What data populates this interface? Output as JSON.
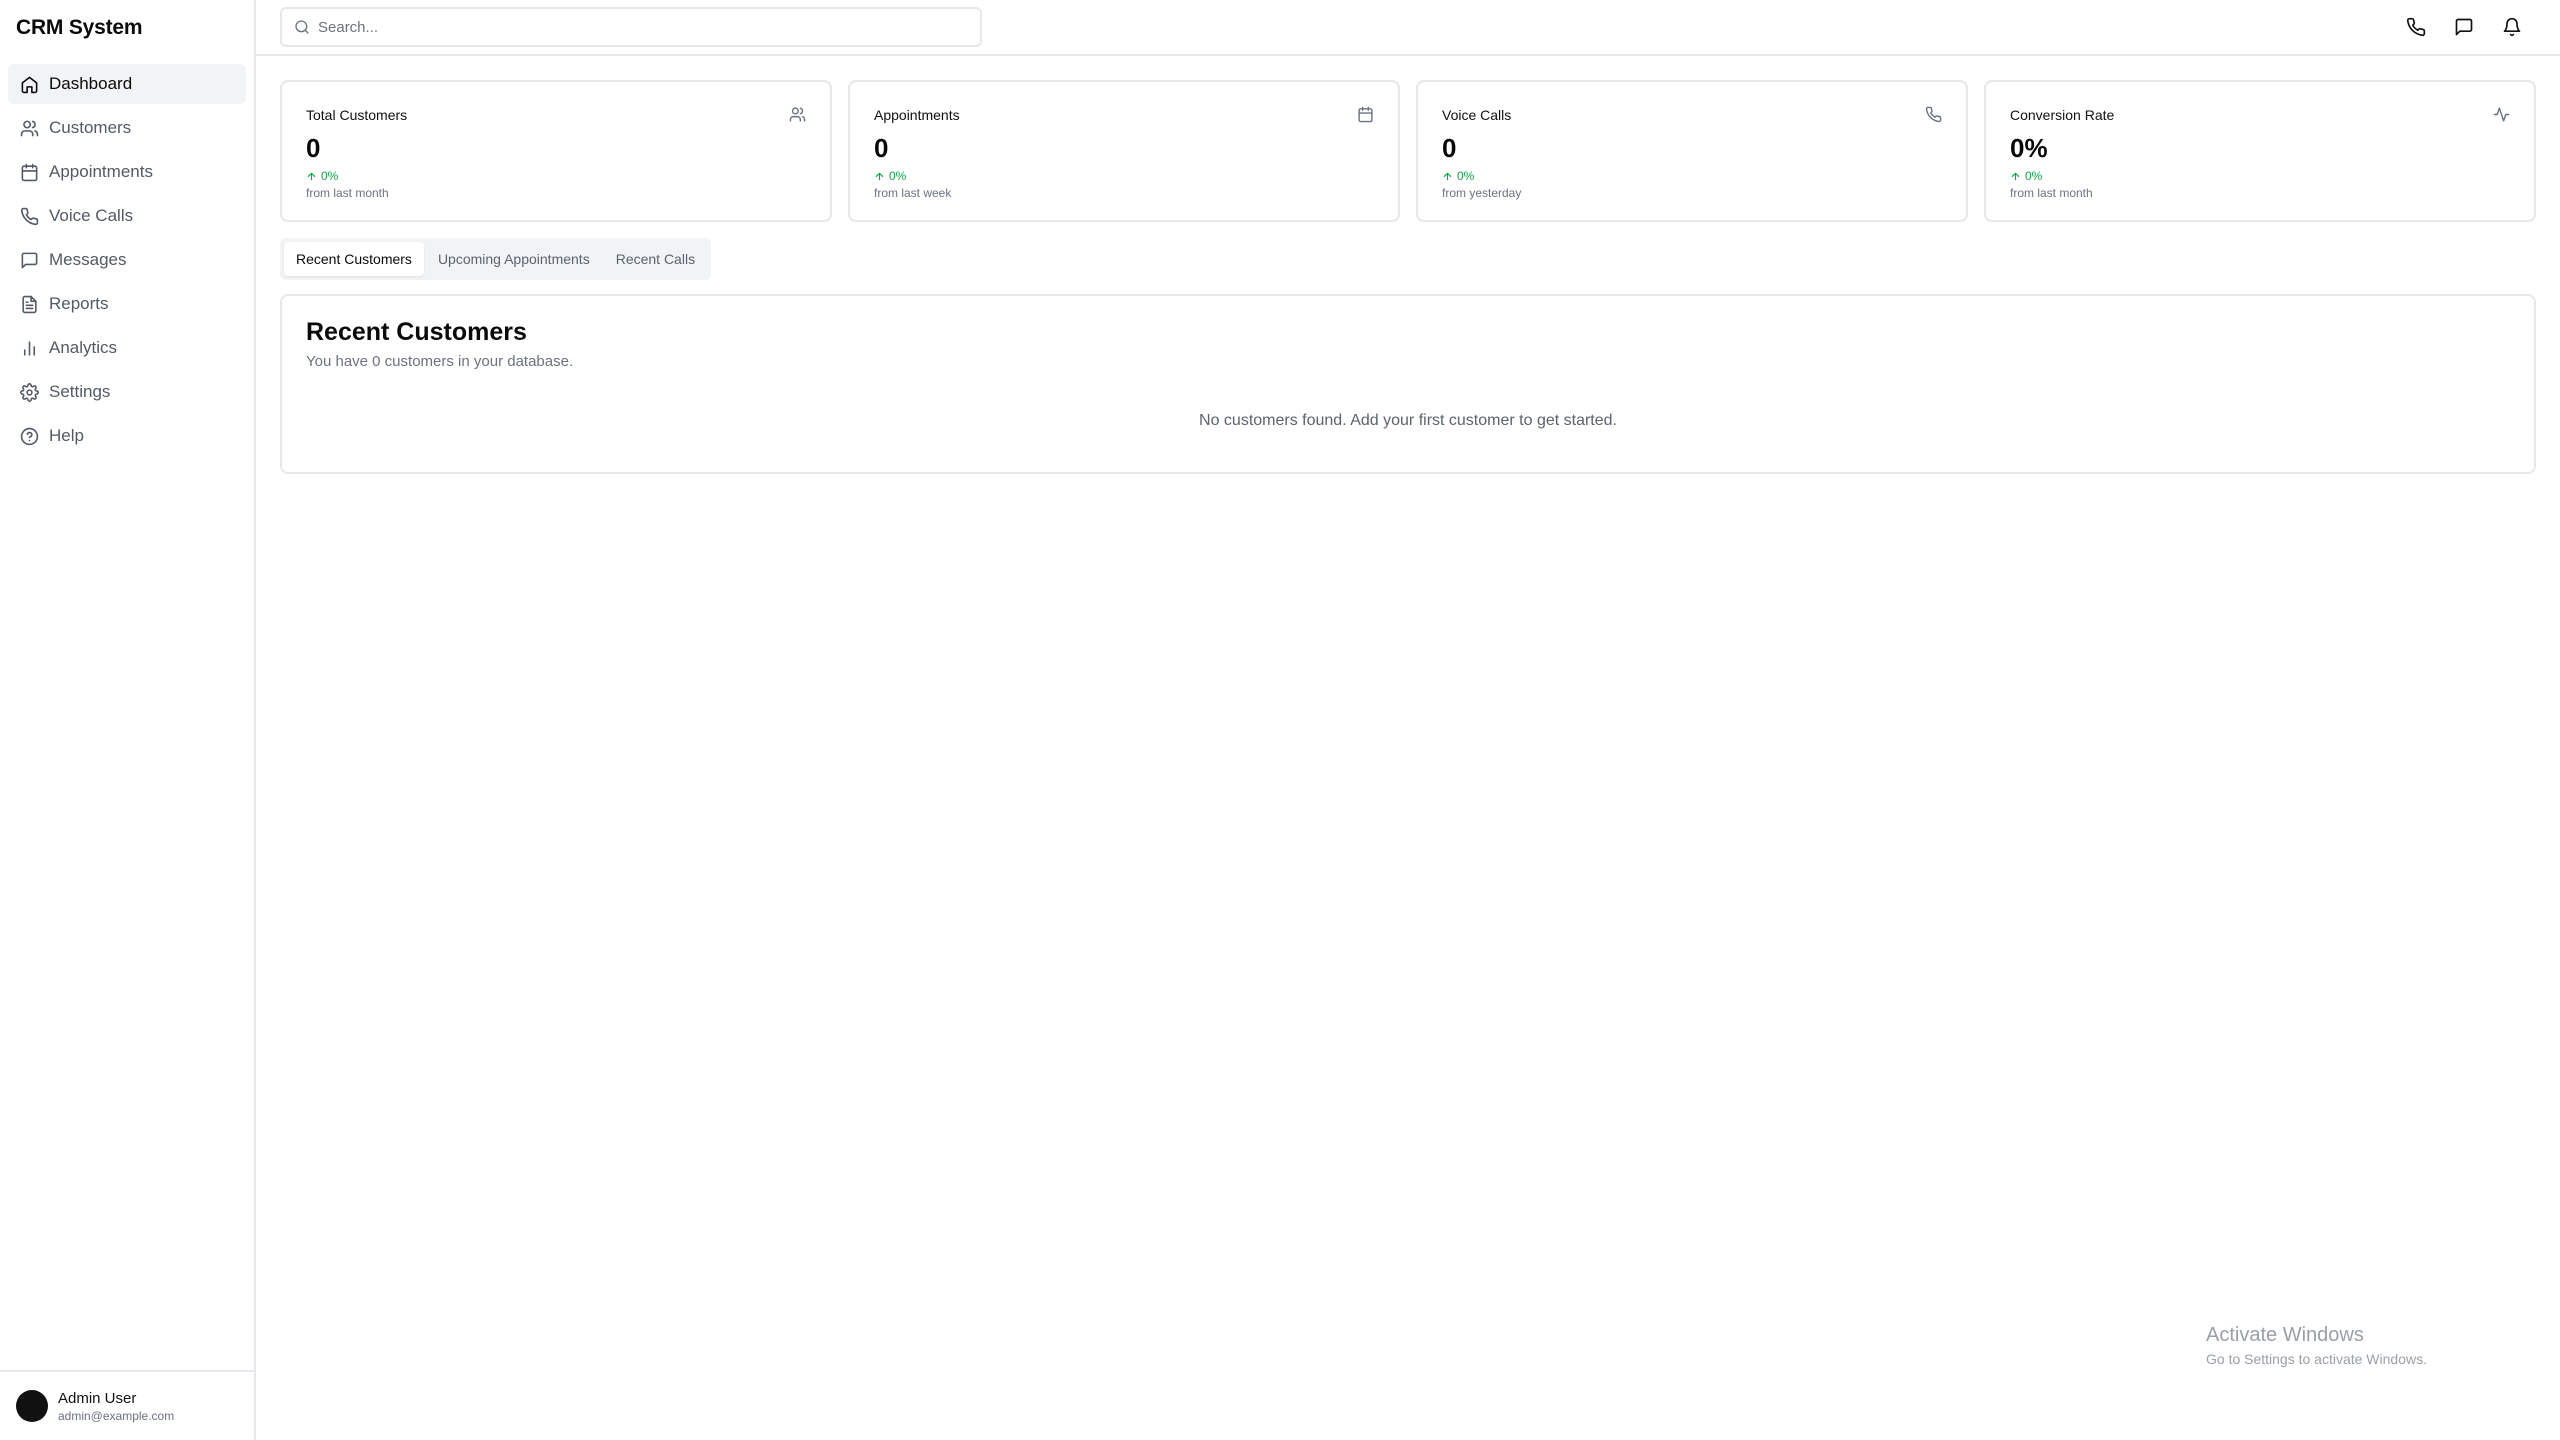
{
  "app": {
    "title": "CRM System"
  },
  "sidebar": {
    "items": [
      {
        "label": "Dashboard",
        "icon": "home-icon",
        "active": true
      },
      {
        "label": "Customers",
        "icon": "users-icon"
      },
      {
        "label": "Appointments",
        "icon": "calendar-icon"
      },
      {
        "label": "Voice Calls",
        "icon": "phone-icon"
      },
      {
        "label": "Messages",
        "icon": "message-icon"
      },
      {
        "label": "Reports",
        "icon": "file-text-icon"
      },
      {
        "label": "Analytics",
        "icon": "bar-chart-icon"
      },
      {
        "label": "Settings",
        "icon": "gear-icon"
      },
      {
        "label": "Help",
        "icon": "help-circle-icon"
      }
    ],
    "user": {
      "name": "Admin User",
      "email": "admin@example.com"
    }
  },
  "topbar": {
    "search_placeholder": "Search...",
    "actions": [
      "phone-icon",
      "message-icon",
      "bell-icon"
    ]
  },
  "stats": [
    {
      "title": "Total Customers",
      "value": "0",
      "change": "0%",
      "sub": "from last month",
      "icon": "users-icon"
    },
    {
      "title": "Appointments",
      "value": "0",
      "change": "0%",
      "sub": "from last week",
      "icon": "calendar-icon"
    },
    {
      "title": "Voice Calls",
      "value": "0",
      "change": "0%",
      "sub": "from yesterday",
      "icon": "phone-icon"
    },
    {
      "title": "Conversion Rate",
      "value": "0%",
      "change": "0%",
      "sub": "from last month",
      "icon": "activity-icon"
    }
  ],
  "tabs": [
    {
      "label": "Recent Customers",
      "active": true
    },
    {
      "label": "Upcoming Appointments"
    },
    {
      "label": "Recent Calls"
    }
  ],
  "panel": {
    "title": "Recent Customers",
    "subtitle": "You have 0 customers in your database.",
    "empty": "No customers found. Add your first customer to get started."
  },
  "watermark": {
    "line1": "Activate Windows",
    "line2": "Go to Settings to activate Windows."
  },
  "colors": {
    "accent_positive": "#16a34a",
    "border": "#e5e7eb",
    "muted": "#6b7280"
  }
}
